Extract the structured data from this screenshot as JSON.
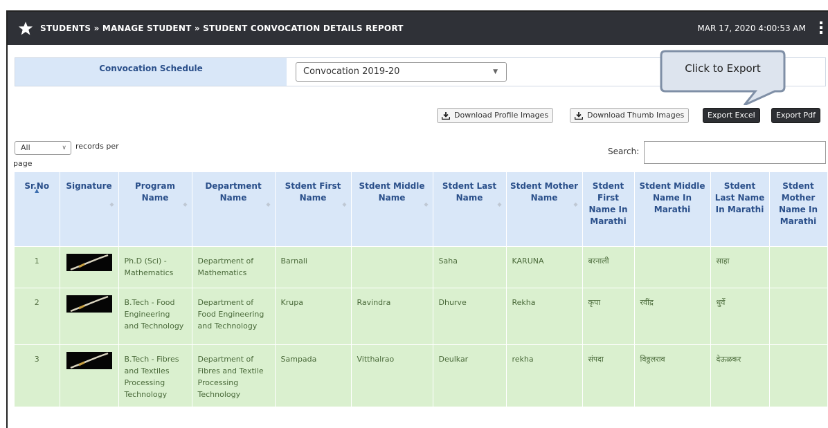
{
  "header": {
    "title": "STUDENTS » MANAGE STUDENT » STUDENT CONVOCATION DETAILS REPORT",
    "datetime": "MAR 17, 2020  4:00:53 AM"
  },
  "schedule": {
    "label": "Convocation Schedule",
    "selected": "Convocation 2019-20"
  },
  "callout": {
    "text": "Click to Export"
  },
  "buttons": {
    "download_profile": "Download Profile Images",
    "download_thumb": "Download Thumb Images",
    "export_excel": "Export Excel",
    "export_pdf": "Export Pdf"
  },
  "records_per_page": {
    "selected": "All",
    "label_a": "records per",
    "label_b": "page"
  },
  "search": {
    "label": "Search:",
    "value": ""
  },
  "table": {
    "columns": [
      "Sr.No",
      "Signature",
      "Program Name",
      "Department Name",
      "Stdent First Name",
      "Stdent Middle Name",
      "Stdent Last Name",
      "Stdent Mother Name",
      "Stdent First Name In Marathi",
      "Stdent Middle Name In Marathi",
      "Stdent Last Name In Marathi",
      "Stdent Mother Name In Marathi"
    ],
    "rows": [
      {
        "sr": "1",
        "program": "Ph.D (Sci) - Mathematics",
        "department": "Department of Mathematics",
        "first": "Barnali",
        "middle": "",
        "last": "Saha",
        "mother": "KARUNA",
        "first_mr": "बरनाली",
        "middle_mr": "",
        "last_mr": "साहा",
        "mother_mr": ""
      },
      {
        "sr": "2",
        "program": "B.Tech - Food Engineering and Technology",
        "department": "Department of Food Engineering and Technology",
        "first": "Krupa",
        "middle": "Ravindra",
        "last": "Dhurve",
        "mother": "Rekha",
        "first_mr": "कृपा",
        "middle_mr": "रवींद्र",
        "last_mr": "धुर्वे",
        "mother_mr": ""
      },
      {
        "sr": "3",
        "program": "B.Tech - Fibres and Textiles Processing Technology",
        "department": "Department of Fibres and Textile Processing Technology",
        "first": "Sampada",
        "middle": "Vitthalrao",
        "last": "Deulkar",
        "mother": "rekha",
        "first_mr": "संपदा",
        "middle_mr": "विठ्ठलराव",
        "last_mr": "देऊळकर",
        "mother_mr": ""
      }
    ]
  },
  "icons": {
    "star": "star-icon",
    "kebab": "kebab-menu-icon",
    "download": "download-icon",
    "sort_asc": "sort-ascending-icon",
    "sort_both": "sort-icon"
  }
}
